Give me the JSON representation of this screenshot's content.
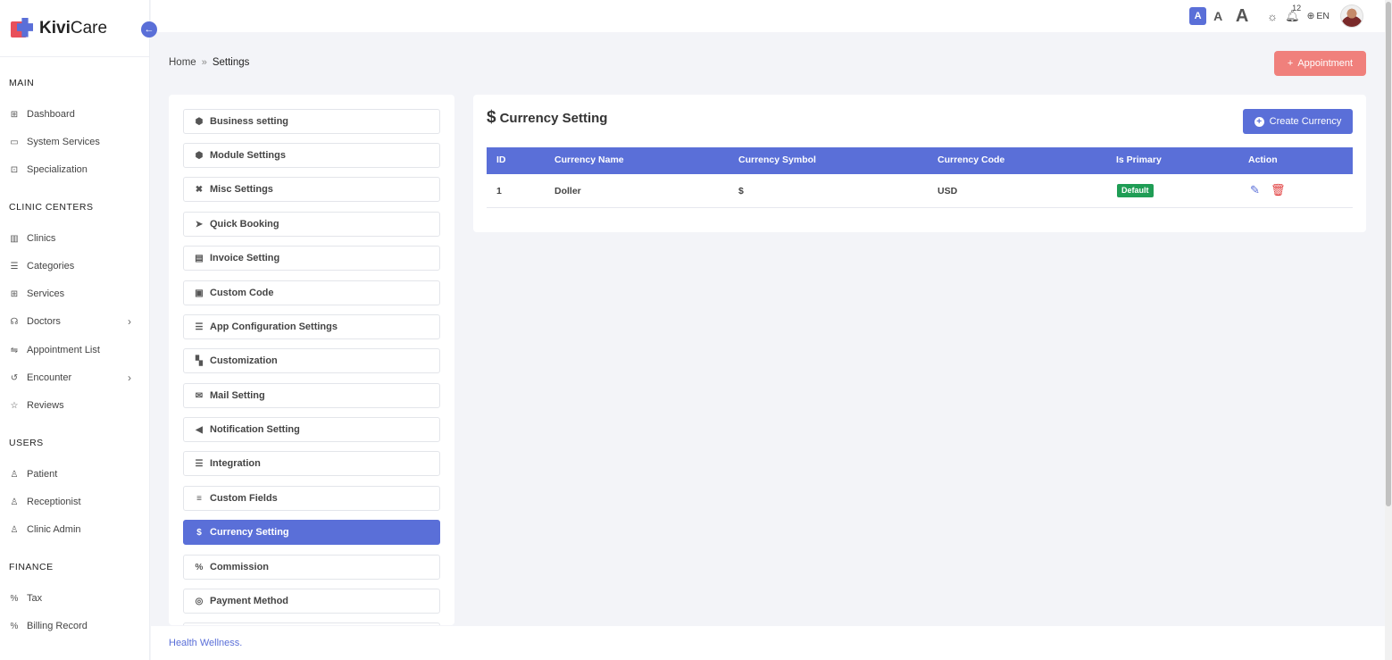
{
  "brand": {
    "name_bold": "Kivi",
    "name_rest": "Care"
  },
  "sidebar": {
    "sections": [
      {
        "title": "MAIN",
        "items": [
          {
            "label": "Dashboard",
            "icon": "grid-icon"
          },
          {
            "label": "System Services",
            "icon": "monitor-icon"
          },
          {
            "label": "Specialization",
            "icon": "award-icon"
          }
        ]
      },
      {
        "title": "CLINIC CENTERS",
        "items": [
          {
            "label": "Clinics",
            "icon": "building-icon"
          },
          {
            "label": "Categories",
            "icon": "list-icon"
          },
          {
            "label": "Services",
            "icon": "briefcase-medical-icon"
          },
          {
            "label": "Doctors",
            "icon": "stethoscope-icon",
            "expandable": true
          },
          {
            "label": "Appointment List",
            "icon": "sliders-icon"
          },
          {
            "label": "Encounter",
            "icon": "history-icon",
            "expandable": true
          },
          {
            "label": "Reviews",
            "icon": "star-icon"
          }
        ]
      },
      {
        "title": "USERS",
        "items": [
          {
            "label": "Patient",
            "icon": "user-icon"
          },
          {
            "label": "Receptionist",
            "icon": "user-icon"
          },
          {
            "label": "Clinic Admin",
            "icon": "user-icon"
          }
        ]
      },
      {
        "title": "FINANCE",
        "items": [
          {
            "label": "Tax",
            "icon": "percent-icon"
          },
          {
            "label": "Billing Record",
            "icon": "percent-icon"
          }
        ]
      }
    ]
  },
  "topbar": {
    "font_small": "A",
    "font_medium": "A",
    "font_large": "A",
    "notification_count": "12",
    "language": "EN"
  },
  "breadcrumb": {
    "home": "Home",
    "current": "Settings"
  },
  "appointment_button": "Appointment",
  "settings_menu": [
    {
      "label": "Business setting",
      "icon": "cube-icon",
      "glyph": "⬢"
    },
    {
      "label": "Module Settings",
      "icon": "cube-icon",
      "glyph": "⬢"
    },
    {
      "label": "Misc Settings",
      "icon": "tools-icon",
      "glyph": "✖"
    },
    {
      "label": "Quick Booking",
      "icon": "paper-plane-icon",
      "glyph": "➤"
    },
    {
      "label": "Invoice Setting",
      "icon": "file-icon",
      "glyph": "▤"
    },
    {
      "label": "Custom Code",
      "icon": "file-code-icon",
      "glyph": "▣"
    },
    {
      "label": "App Configuration Settings",
      "icon": "sliders-icon",
      "glyph": "☰"
    },
    {
      "label": "Customization",
      "icon": "palette-icon",
      "glyph": "▚"
    },
    {
      "label": "Mail Setting",
      "icon": "envelope-icon",
      "glyph": "✉"
    },
    {
      "label": "Notification Setting",
      "icon": "bullhorn-icon",
      "glyph": "◀"
    },
    {
      "label": "Integration",
      "icon": "sliders-icon",
      "glyph": "☰"
    },
    {
      "label": "Custom Fields",
      "icon": "bars-icon",
      "glyph": "≡"
    },
    {
      "label": "Currency Setting",
      "icon": "dollar-icon",
      "glyph": "$",
      "active": true
    },
    {
      "label": "Commission",
      "icon": "percent-icon",
      "glyph": "%"
    },
    {
      "label": "Payment Method",
      "icon": "coins-icon",
      "glyph": "◎"
    }
  ],
  "currency": {
    "title": "Currency Setting",
    "create_button": "Create Currency",
    "columns": [
      "ID",
      "Currency Name",
      "Currency Symbol",
      "Currency Code",
      "Is Primary",
      "Action"
    ],
    "rows": [
      {
        "id": "1",
        "name": "Doller",
        "symbol": "$",
        "code": "USD",
        "primary": "Default"
      }
    ]
  },
  "footer": {
    "text": "Health Wellness."
  },
  "colors": {
    "accent": "#5a6fd8",
    "danger": "#f0807c",
    "success": "#1f9d55"
  }
}
